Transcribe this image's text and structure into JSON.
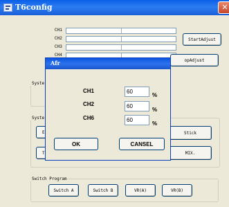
{
  "window": {
    "title": "T6config",
    "close_glyph": "✕"
  },
  "channels": [
    {
      "label": "CH1"
    },
    {
      "label": "CH2"
    },
    {
      "label": "CH3"
    },
    {
      "label": "CH4"
    }
  ],
  "buttons": {
    "start_adjust": "StartAdjust",
    "stop_adjust": "opAdjust",
    "stick": "Stick",
    "mix": "MIX."
  },
  "groups": {
    "system1": "Syste",
    "system2": "Syster",
    "switch_program": "Switch Program"
  },
  "partials": {
    "en": "En",
    "th": "Th"
  },
  "switch_program": {
    "buttons": [
      "Switch A",
      "Switch B",
      "VR(A)",
      "VR(B)"
    ]
  },
  "dialog": {
    "title": "Afr",
    "rows": [
      {
        "label": "CH1",
        "value": "60",
        "unit": "%"
      },
      {
        "label": "CH2",
        "value": "60",
        "unit": "%"
      },
      {
        "label": "CH6",
        "value": "60",
        "unit": "%"
      }
    ],
    "ok_label": "OK",
    "cancel_label": "CANSEL"
  }
}
